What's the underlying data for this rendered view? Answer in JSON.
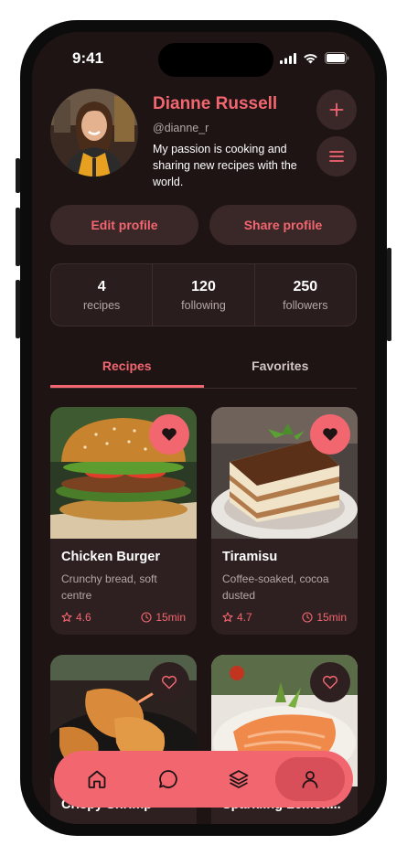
{
  "status_bar": {
    "time": "9:41"
  },
  "profile": {
    "name": "Dianne Russell",
    "handle": "@dianne_r",
    "bio": "My passion is cooking and sharing new recipes with the world."
  },
  "actions": {
    "edit": "Edit profile",
    "share": "Share profile"
  },
  "stats": [
    {
      "value": "4",
      "label": "recipes"
    },
    {
      "value": "120",
      "label": "following"
    },
    {
      "value": "250",
      "label": "followers"
    }
  ],
  "tabs": [
    {
      "label": "Recipes",
      "active": true
    },
    {
      "label": "Favorites",
      "active": false
    }
  ],
  "recipes": [
    {
      "title": "Chicken Burger",
      "description": "Crunchy bread, soft centre",
      "rating": "4.6",
      "time": "15min",
      "favorited": true
    },
    {
      "title": "Tiramisu",
      "description": "Coffee-soaked, cocoa dusted",
      "rating": "4.7",
      "time": "15min",
      "favorited": true
    },
    {
      "title": "Crispy Shrimp",
      "favorited": false
    },
    {
      "title": "Sparkling Lemon...",
      "favorited": false
    }
  ],
  "nav": [
    "home-icon",
    "chat-icon",
    "layers-icon",
    "user-icon"
  ],
  "colors": {
    "accent": "#f26670",
    "background": "#1e1414",
    "surface": "#3a2727",
    "card": "#2e2020"
  }
}
